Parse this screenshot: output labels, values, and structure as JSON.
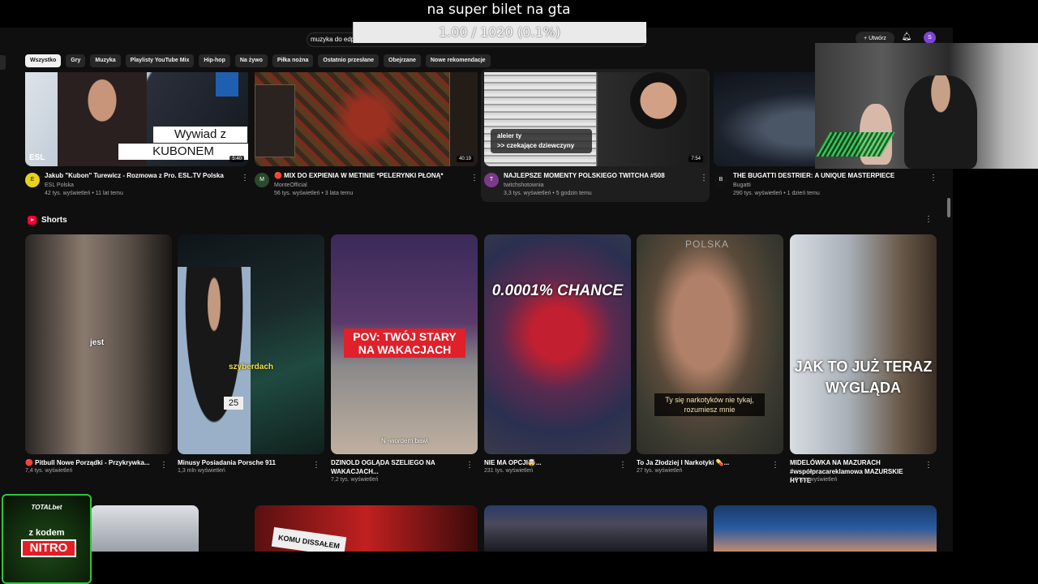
{
  "overlay": {
    "title": "na super bilet na gta",
    "progress_text": "1.00 / 1020 (0.1%)",
    "progress_fraction": 0.001
  },
  "header": {
    "search_value": "muzyka do edp",
    "create_label": "Utwórz",
    "avatar_letter": "S"
  },
  "chips": [
    "Wszystko",
    "Gry",
    "Muzyka",
    "Playlisty YouTube Mix",
    "Hip-hop",
    "Na żywo",
    "Piłka nożna",
    "Ostatnio przesłane",
    "Obejrzane",
    "Nowe rekomendacje"
  ],
  "videos": [
    {
      "title": "Jakub \"Kubon\" Turewicz - Rozmowa z Pro. ESL.TV Polska",
      "channel": "ESL Polska",
      "meta": "42 tys. wyświetleń • 11 lat temu",
      "duration": "5:40",
      "thumb_caption_1": "Wywiad z",
      "thumb_caption_2": "KUBONEM",
      "thumb_brand": "ESL",
      "avatar_text": "E"
    },
    {
      "title": "🔴 MIX DO EXPIENIA  W METINIE *PELERYNKI PŁONĄ*",
      "channel": "MonteOfficial",
      "meta": "56 tys. wyświetleń • 3 lata temu",
      "duration": "40:19",
      "avatar_text": "M"
    },
    {
      "title": "NAJLEPSZE MOMENTY POLSKIEGO TWITCHA #508",
      "channel": "twitchshotownia",
      "meta": "3,3 tys. wyświetleń • 5 godzin temu",
      "duration": "7:54",
      "thumb_caption_1": "aleier ty",
      "thumb_caption_2": ">> czekające dziewczyny",
      "avatar_text": "T"
    },
    {
      "title": "THE BUGATTI DESTRIER: A UNIQUE MASTERPIECE",
      "channel": "Bugatti",
      "meta": "290 tys. wyświetleń • 1 dzień temu",
      "avatar_text": "B"
    }
  ],
  "shorts": {
    "title": "Shorts",
    "items": [
      {
        "title": "🔴 Pitbull Nowe Porządki - Przykrywka...",
        "meta": "7,4 tys. wyświetleń",
        "overlay_text": "jest"
      },
      {
        "title": "Minusy Posiadania Porsche 911",
        "meta": "1,3 mln wyświetleń",
        "overlay_text": "szyberdach",
        "plate": "25"
      },
      {
        "title": "DZINOLD OGLĄDA SZELIEGO NA WAKACJACH...",
        "meta": "7,2 tys. wyświetleń",
        "overlay_text": "POV: TWÓJ STARY NA WAKACJACH",
        "subtitle": "N -wordem bawi"
      },
      {
        "title": "NIE MA OPCJI🤯...",
        "meta": "231 tys. wyświetleń",
        "overlay_text": "0.0001% CHANCE"
      },
      {
        "title": "To Ja Złodziej I Narkotyki 💊...",
        "meta": "27 tys. wyświetleń",
        "overlay_text": "Ty się narkotyków nie tykaj, rozumiesz mnie",
        "corner_text": "POLSKA"
      },
      {
        "title": "MIDELÓWKA NA MAZURACH #współpracareklamowa MAZURSKIE HYTTE",
        "meta": "1,6 tys. wyświetleń",
        "overlay_text": "JAK TO JUŻ TERAZ WYGLĄDA"
      }
    ]
  },
  "bottom_row": {
    "caption": "KOMU DISSAŁEM"
  },
  "promo": {
    "brand": "TOTALbet",
    "line1": "z kodem",
    "code": "NITRO"
  },
  "colors": {
    "accent": "#ff0033",
    "promo_green": "#2ec63c",
    "background": "#0f0f0f"
  }
}
